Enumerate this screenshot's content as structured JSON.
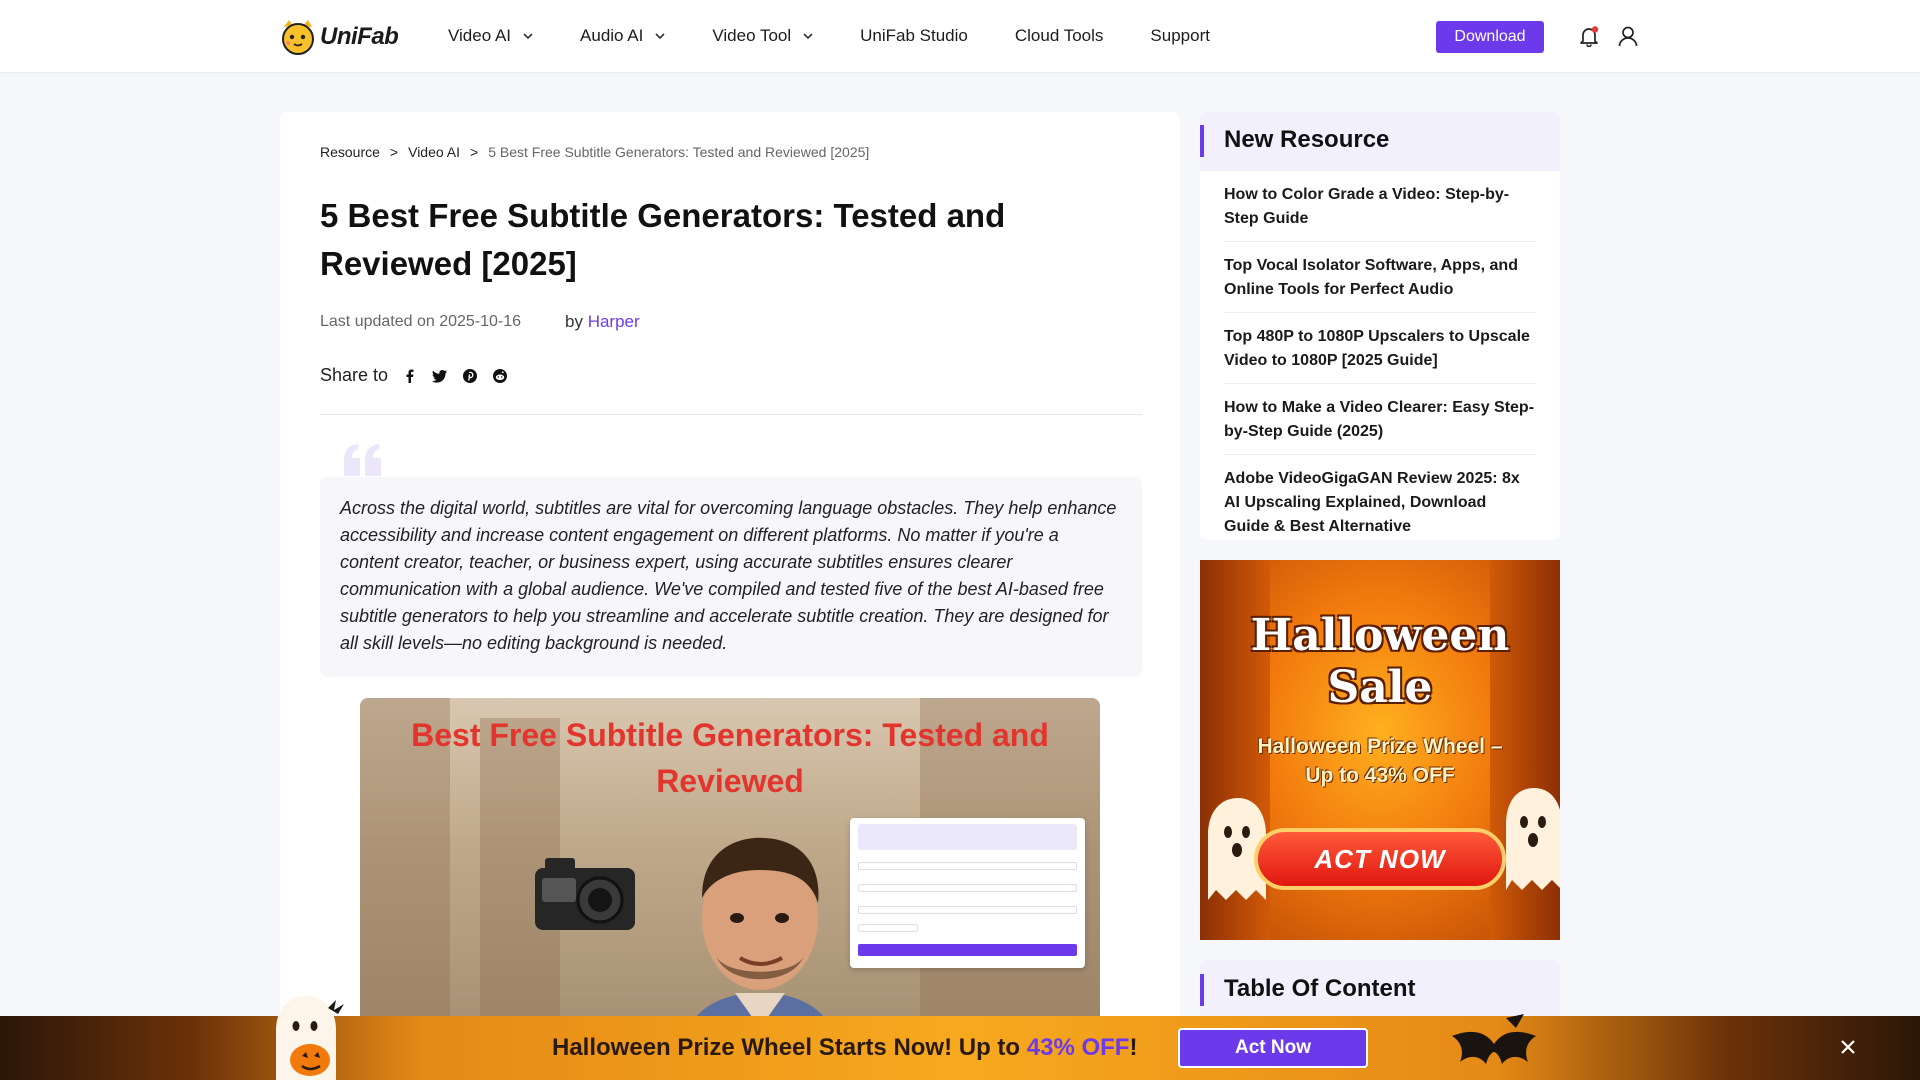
{
  "header": {
    "logo_text": "UniFab",
    "nav": [
      {
        "label": "Video AI",
        "has_dropdown": true
      },
      {
        "label": "Audio AI",
        "has_dropdown": true
      },
      {
        "label": "Video Tool",
        "has_dropdown": true
      },
      {
        "label": "UniFab Studio",
        "has_dropdown": false
      },
      {
        "label": "Cloud Tools",
        "has_dropdown": false
      },
      {
        "label": "Support",
        "has_dropdown": false
      }
    ],
    "download_label": "Download",
    "icons": [
      "bell-icon",
      "user-icon"
    ],
    "accent_color": "#6c3aeb"
  },
  "article": {
    "breadcrumb": [
      "Resource",
      "Video AI",
      "5 Best Free Subtitle Generators: Tested and Reviewed [2025]"
    ],
    "breadcrumb_sep": ">",
    "title": "5 Best Free Subtitle Generators: Tested and Reviewed [2025]",
    "updated": "Last updated on 2025-10-16",
    "by": "by",
    "author": "Harper",
    "share_label": "Share to",
    "share_icons": [
      "facebook-icon",
      "twitter-icon",
      "pinterest-icon",
      "reddit-icon"
    ],
    "intro": "Across the digital world, subtitles are vital for overcoming language obstacles. They help enhance accessibility and increase content engagement on different platforms. No matter if you're a content creator, teacher, or business expert, using accurate subtitles ensures clearer communication with a global audience. We've compiled and tested five of the best AI-based free subtitle generators to help you streamline and accelerate subtitle creation. They are designed for all skill levels—no editing background is needed.",
    "hero_title_line1": "Best Free Subtitle Generators: Tested and",
    "hero_title_line2": "Reviewed"
  },
  "sidebar": {
    "new_resource_title": "New Resource",
    "items": [
      {
        "label": "How to Color Grade a Video: Step-by-Step Guide"
      },
      {
        "label": "Top Vocal Isolator Software, Apps, and Online Tools for Perfect Audio"
      },
      {
        "label": "Top 480P to 1080P Upscalers to Upscale Video to 1080P [2025 Guide]"
      },
      {
        "label": "How to Make a Video Clearer: Easy Step-by-Step Guide (2025)"
      },
      {
        "label": "Adobe VideoGigaGAN Review 2025: 8x AI Upscaling Explained, Download Guide & Best Alternative"
      }
    ],
    "promo": {
      "title_line1": "Halloween",
      "title_line2": "Sale",
      "subtitle_line1": "Halloween Prize Wheel –",
      "subtitle_line2": "Up to 43% OFF",
      "button": "ACT NOW"
    },
    "toc_title": "Table Of Content"
  },
  "banner": {
    "text_before": "Halloween Prize Wheel Starts Now! Up to ",
    "text_highlight": "43% OFF",
    "text_after": "!",
    "button": "Act Now",
    "close_icon": "close-icon"
  }
}
